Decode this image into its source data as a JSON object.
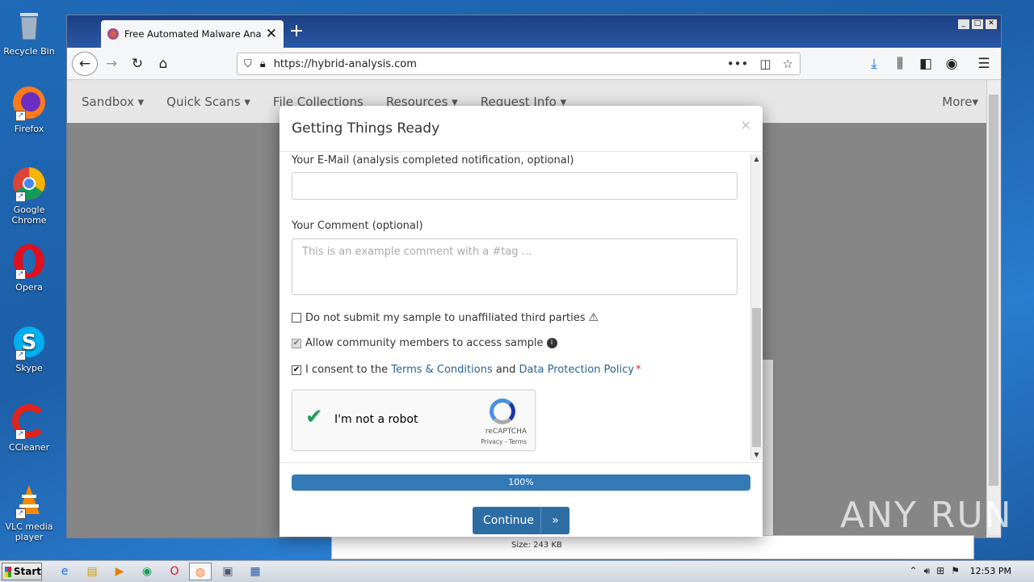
{
  "desktop": {
    "icons": [
      {
        "label": "Recycle Bin"
      },
      {
        "label": "Firefox"
      },
      {
        "label": "Google Chrome"
      },
      {
        "label": "Opera"
      },
      {
        "label": "Skype"
      },
      {
        "label": "CCleaner"
      },
      {
        "label": "VLC media player"
      }
    ],
    "watermark": "ANY RUN"
  },
  "browser": {
    "tab_title": "Free Automated Malware Analysis",
    "tab_close": "✕",
    "new_tab": "+",
    "url": "https://hybrid-analysis.com",
    "window_buttons": [
      "_",
      "□",
      "✕"
    ]
  },
  "site_nav": {
    "items": [
      "Sandbox ▾",
      "Quick Scans ▾",
      "File Collections",
      "Resources ▾",
      "Request Info ▾"
    ],
    "more": "More▾"
  },
  "modal": {
    "title": "Getting Things Ready",
    "close": "×",
    "email_label": "Your E-Mail (analysis completed notification, optional)",
    "comment_label": "Your Comment (optional)",
    "comment_placeholder": "This is an example comment with a #tag ...",
    "opt_third_party": "Do not submit my sample to unaffiliated third parties",
    "opt_community": "Allow community members to access sample",
    "consent_prefix": "I consent to the",
    "consent_terms": "Terms & Conditions",
    "consent_and": "and",
    "consent_privacy": "Data Protection Policy",
    "required_mark": "*",
    "captcha_text": "I'm not a robot",
    "captcha_brand": "reCAPTCHA",
    "captcha_links": "Privacy - Terms",
    "progress_label": "100%",
    "progress": 1.0,
    "continue_label": "Continue",
    "continue_icon": "»"
  },
  "background_page": {
    "file_size": "Size: 243 KB"
  },
  "taskbar": {
    "start_label": "Start",
    "clock": "12:53 PM"
  }
}
